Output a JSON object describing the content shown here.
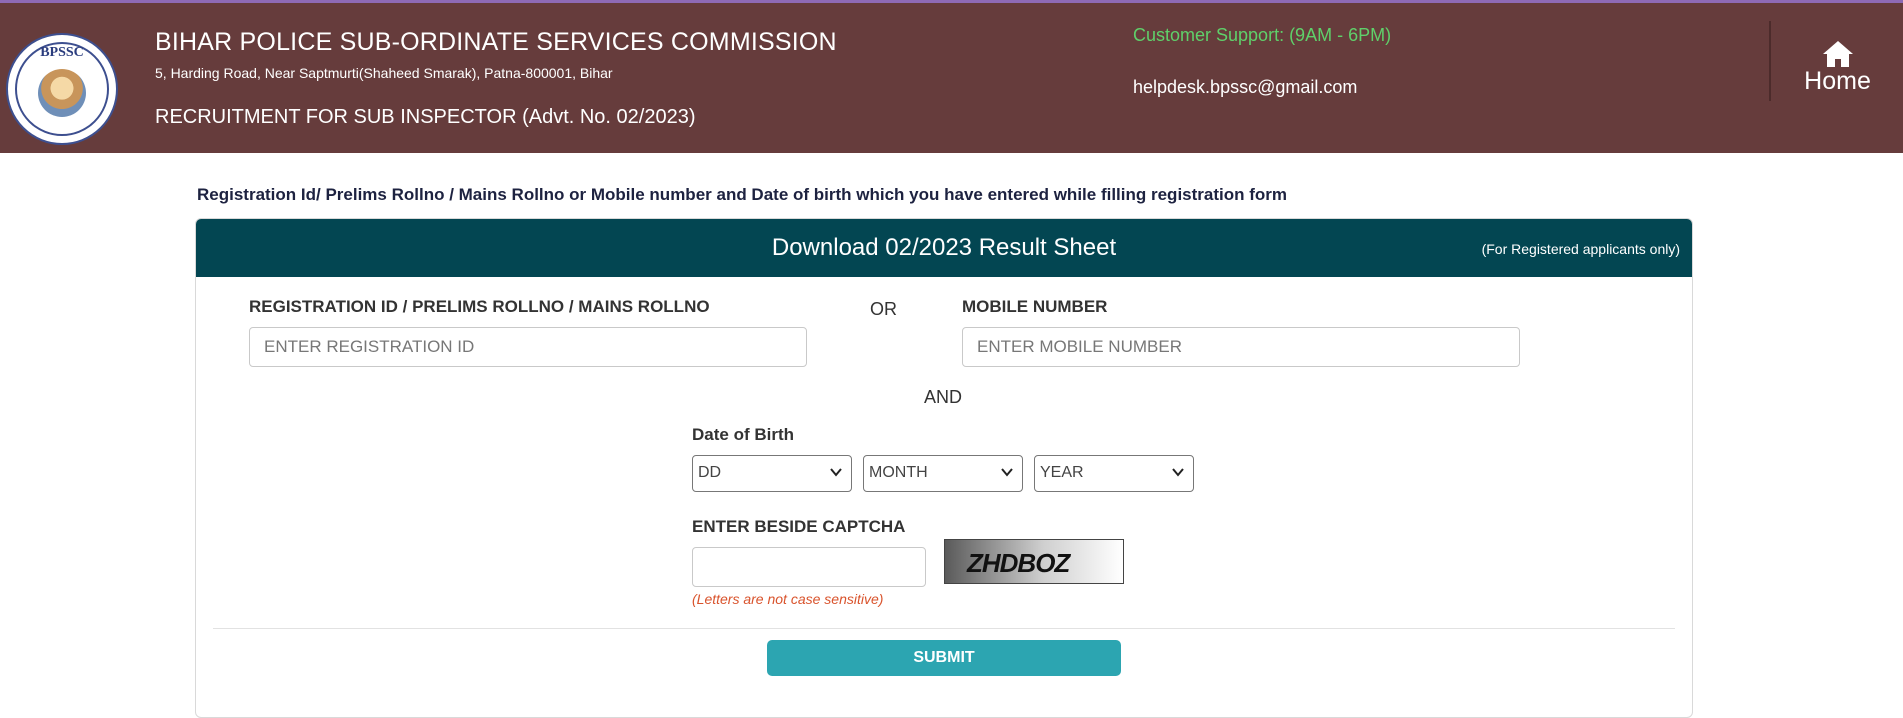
{
  "header": {
    "logo_text": "BPSSC",
    "title": "BIHAR POLICE SUB-ORDINATE SERVICES COMMISSION",
    "address": "5, Harding Road, Near Saptmurti(Shaheed Smarak), Patna-800001, Bihar",
    "recruitment": "RECRUITMENT FOR SUB INSPECTOR (Advt. No. 02/2023)",
    "support": "Customer Support: (9AM - 6PM)",
    "email": "helpdesk.bpssc@gmail.com",
    "home_label": "Home",
    "home_icon": "home-icon"
  },
  "instruction": "Registration Id/ Prelims Rollno / Mains Rollno or Mobile number and Date of birth which you have entered while filling registration form",
  "card": {
    "title": "Download 02/2023 Result Sheet",
    "note": "(For Registered applicants only)"
  },
  "form": {
    "registration_label": "REGISTRATION ID / PRELIMS ROLLNO / MAINS ROLLNO",
    "registration_placeholder": "ENTER REGISTRATION ID",
    "or_text": "OR",
    "mobile_label": "MOBILE NUMBER",
    "mobile_placeholder": "ENTER MOBILE NUMBER",
    "and_text": "AND",
    "dob_label": "Date of Birth",
    "day": "DD",
    "month": "MONTH",
    "year": "YEAR",
    "captcha_label": "ENTER BESIDE CAPTCHA",
    "captcha_text": "ZHDBOZ",
    "captcha_hint": "(Letters are not case sensitive)",
    "submit_label": "SUBMIT"
  },
  "colors": {
    "header_bg": "#663c3c",
    "card_header_bg": "#034652",
    "support_text": "#5fd06a",
    "submit_bg": "#2ca5b1",
    "hint_text": "#d9532c"
  }
}
